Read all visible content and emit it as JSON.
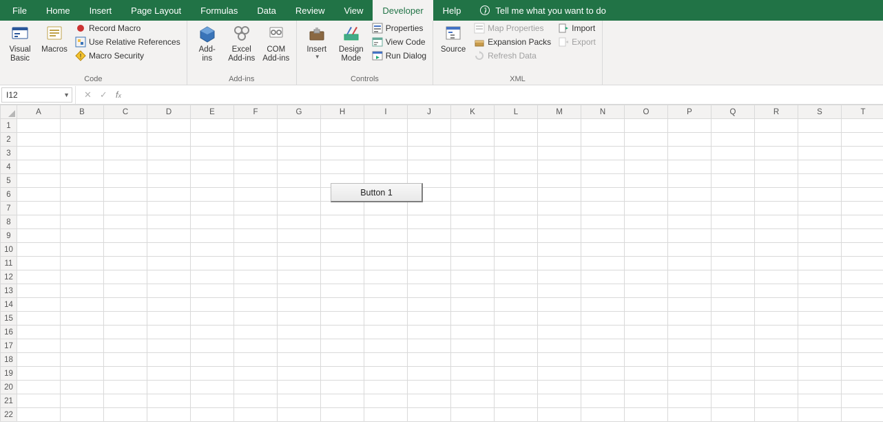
{
  "tabs": {
    "file": "File",
    "home": "Home",
    "insert": "Insert",
    "page_layout": "Page Layout",
    "formulas": "Formulas",
    "data": "Data",
    "review": "Review",
    "view": "View",
    "developer": "Developer",
    "help": "Help",
    "tell_me": "Tell me what you want to do"
  },
  "ribbon": {
    "code": {
      "label": "Code",
      "visual_basic": "Visual\nBasic",
      "macros": "Macros",
      "record_macro": "Record Macro",
      "use_relative": "Use Relative References",
      "macro_security": "Macro Security"
    },
    "addins": {
      "label": "Add-ins",
      "addins": "Add-\nins",
      "excel_addins": "Excel\nAdd-ins",
      "com_addins": "COM\nAdd-ins"
    },
    "controls": {
      "label": "Controls",
      "insert": "Insert",
      "design_mode": "Design\nMode",
      "properties": "Properties",
      "view_code": "View Code",
      "run_dialog": "Run Dialog"
    },
    "xml": {
      "label": "XML",
      "source": "Source",
      "map_properties": "Map Properties",
      "expansion_packs": "Expansion Packs",
      "refresh_data": "Refresh Data",
      "import": "Import",
      "export": "Export"
    }
  },
  "formula_bar": {
    "cell_ref": "I12",
    "formula": ""
  },
  "grid": {
    "columns": [
      "A",
      "B",
      "C",
      "D",
      "E",
      "F",
      "G",
      "H",
      "I",
      "J",
      "K",
      "L",
      "M",
      "N",
      "O",
      "P",
      "Q",
      "R",
      "S",
      "T"
    ],
    "row_count": 22
  },
  "form_control": {
    "button1_label": "Button 1"
  }
}
